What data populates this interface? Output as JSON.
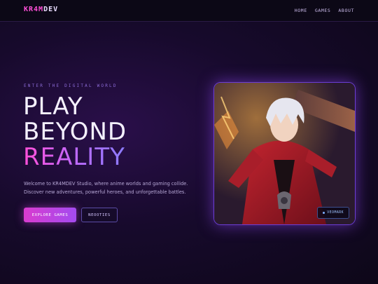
{
  "brand": {
    "logo_accent": "KR4M",
    "logo_rest": "DEV"
  },
  "nav": {
    "items": [
      {
        "label": "HOME"
      },
      {
        "label": "GAMES"
      },
      {
        "label": "ABOUT"
      }
    ]
  },
  "hero": {
    "eyebrow": "ENTER THE DIGITAL WORLD",
    "title_line1": "PLAY",
    "title_line2": "BEYOND",
    "title_line3": "REALITY",
    "description_line1": "Welcome to KR4MDEV Studio, where anime worlds and gaming collide.",
    "description_line2": "Discover new adventures, powerful heroes, and unforgettable battles.",
    "primary_button": "EXPLORE GAMES",
    "secondary_button": "NEOOTIES"
  },
  "card": {
    "badge": "VEOMARK"
  },
  "colors": {
    "accent_pink": "#ff4fd8",
    "accent_purple": "#a34bf0",
    "background": "#170a2c"
  }
}
